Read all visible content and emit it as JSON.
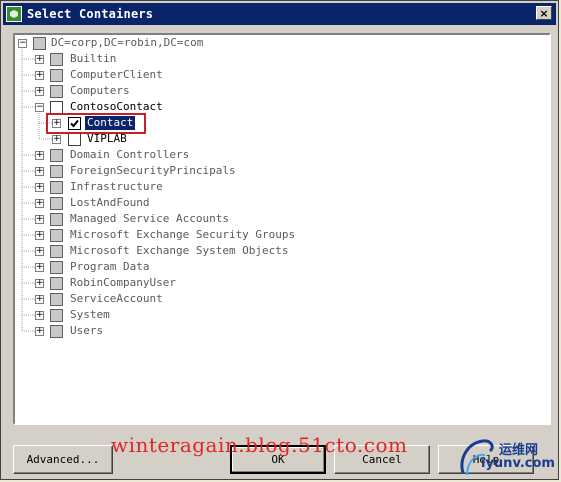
{
  "window": {
    "title": "Select Containers",
    "close_glyph": "×"
  },
  "tree": {
    "root": {
      "label": "DC=corp,DC=robin,DC=com",
      "expander": "−"
    },
    "items": [
      {
        "label": "Builtin",
        "expander": "+"
      },
      {
        "label": "ComputerClient",
        "expander": "+"
      },
      {
        "label": "Computers",
        "expander": "+"
      },
      {
        "label": "ContosoContact",
        "expander": "−",
        "expanded": true
      },
      {
        "label": "Contact",
        "expander": "+",
        "checked": true,
        "selected": true
      },
      {
        "label": "VIPLAB",
        "expander": "+"
      },
      {
        "label": "Domain Controllers",
        "expander": "+"
      },
      {
        "label": "ForeignSecurityPrincipals",
        "expander": "+"
      },
      {
        "label": "Infrastructure",
        "expander": "+"
      },
      {
        "label": "LostAndFound",
        "expander": "+"
      },
      {
        "label": "Managed Service Accounts",
        "expander": "+"
      },
      {
        "label": "Microsoft Exchange Security Groups",
        "expander": "+"
      },
      {
        "label": "Microsoft Exchange System Objects",
        "expander": "+"
      },
      {
        "label": "Program Data",
        "expander": "+"
      },
      {
        "label": "RobinCompanyUser",
        "expander": "+"
      },
      {
        "label": "ServiceAccount",
        "expander": "+"
      },
      {
        "label": "System",
        "expander": "+"
      },
      {
        "label": "Users",
        "expander": "+"
      }
    ]
  },
  "buttons": {
    "advanced": "Advanced...",
    "ok": "OK",
    "cancel": "Cancel",
    "help": "Help"
  },
  "watermark": {
    "text": "winteragain.blog.51cto.com"
  },
  "logo": {
    "top_text": "运维网",
    "bottom_text": "iyunv.com"
  },
  "colors": {
    "title_bar": "#0a246a",
    "selection": "#0a246a",
    "highlight_box": "#c8202a",
    "watermark": "#e21c1c"
  }
}
